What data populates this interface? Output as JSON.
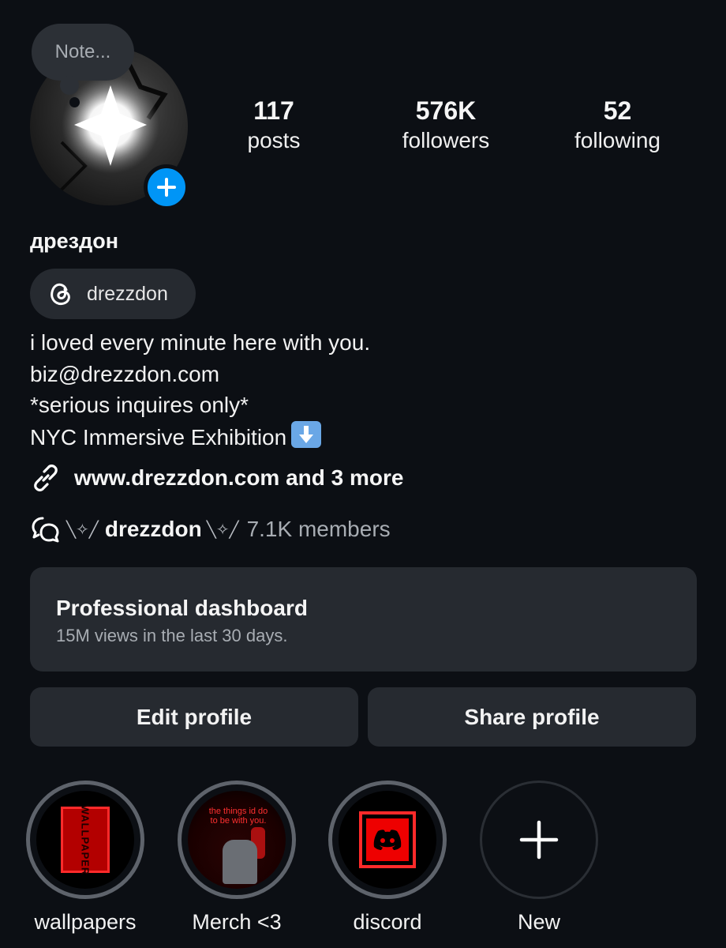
{
  "note": {
    "placeholder": "Note..."
  },
  "profile": {
    "display_name": "дрездон",
    "threads_handle": "drezzdon",
    "bio_lines": [
      "i loved every minute here with you.",
      "biz@drezzdon.com",
      "*serious inquires only*",
      "NYC Immersive Exhibition"
    ],
    "bio_emoji": "down-arrow-emoji",
    "link_text": "www.drezzdon.com and 3 more",
    "channel": {
      "wing_left": "╲✧╱",
      "name": "drezzdon",
      "wing_right": "╲✧╱",
      "members": "7.1K members"
    }
  },
  "stats": {
    "posts": {
      "value": "117",
      "label": "posts"
    },
    "followers": {
      "value": "576K",
      "label": "followers"
    },
    "following": {
      "value": "52",
      "label": "following"
    }
  },
  "dashboard": {
    "title": "Professional dashboard",
    "subtitle": "15M views in the last 30 days."
  },
  "buttons": {
    "edit": "Edit profile",
    "share": "Share profile"
  },
  "highlights": [
    {
      "label": "wallpapers",
      "cover_text": "WALLPAPER"
    },
    {
      "label": "Merch <3",
      "cover_text": "the things id do to be with you."
    },
    {
      "label": "discord"
    },
    {
      "label": "New"
    }
  ],
  "icons": {
    "add_story": "plus-icon",
    "threads": "threads-icon",
    "link": "link-icon",
    "channel": "broadcast-chat-icon",
    "new_highlight": "plus-icon"
  },
  "colors": {
    "background": "#0c0f14",
    "card": "#262a30",
    "accent_blue": "#0095f6",
    "secondary_text": "#a8adb3",
    "highlight_red": "#ff2a2a"
  }
}
